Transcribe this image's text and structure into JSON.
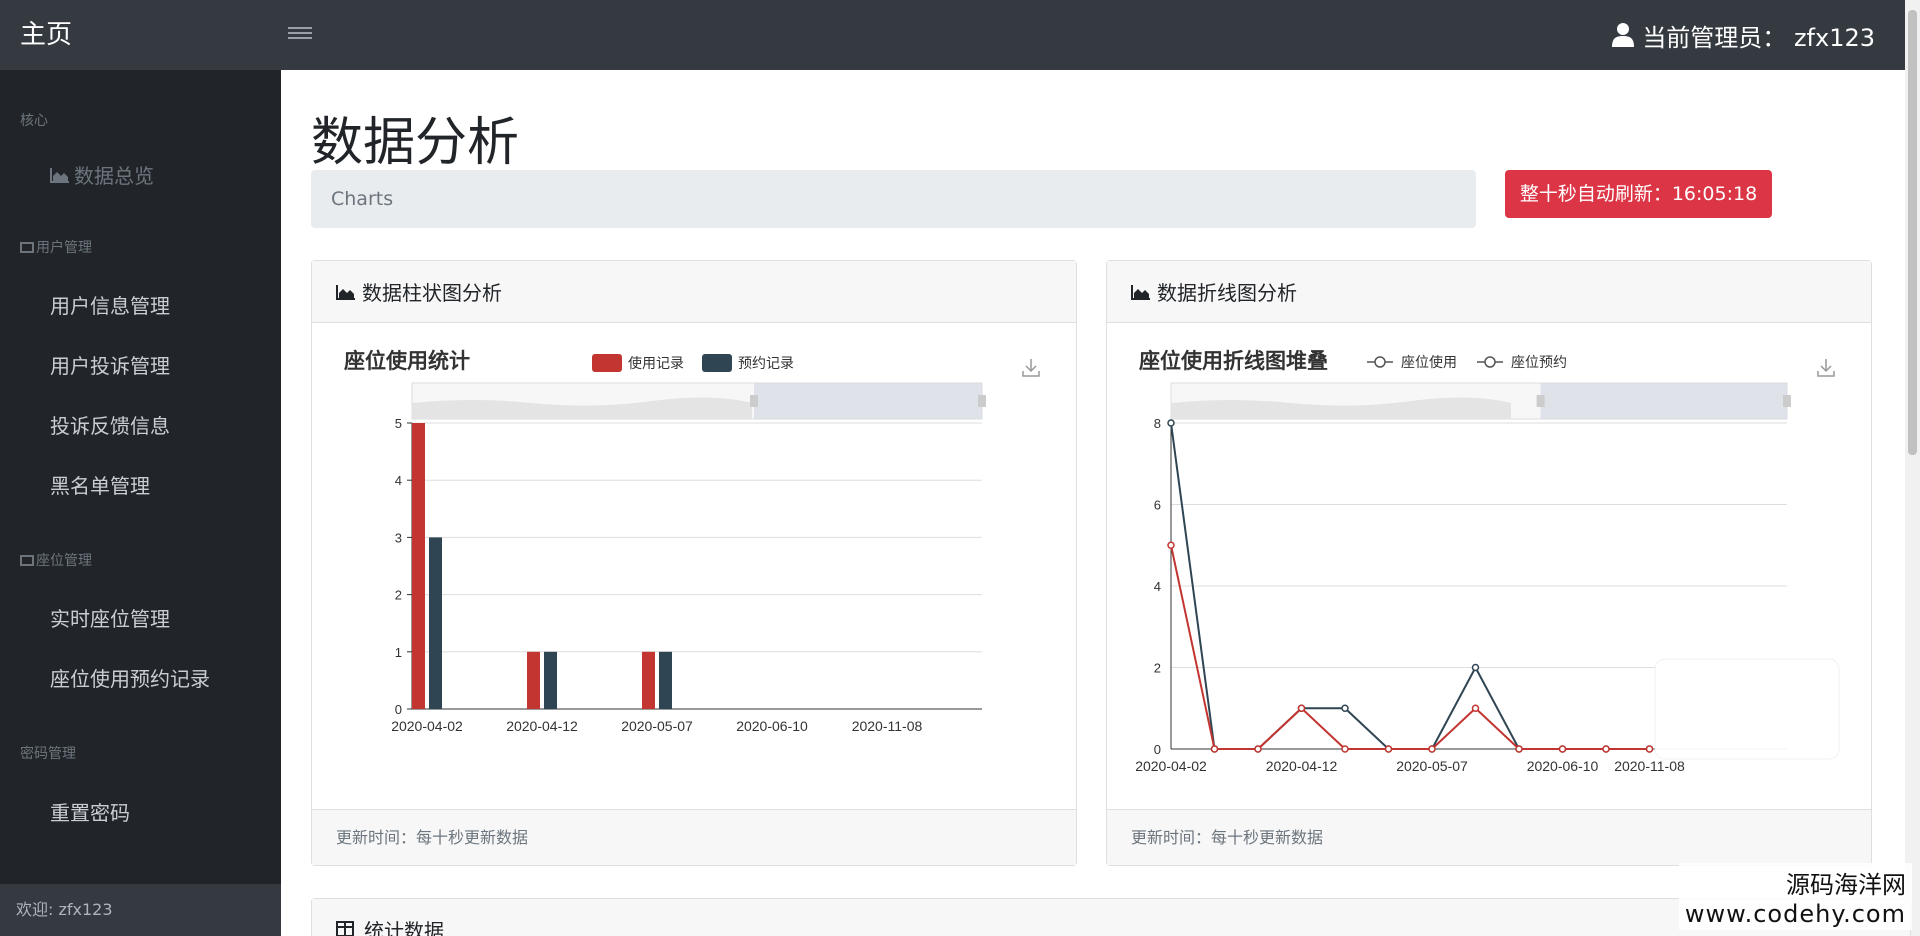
{
  "navbar": {
    "brand": "主页",
    "admin_label": "当前管理员：  zfx123"
  },
  "sidebar": {
    "sections": [
      {
        "heading": "核心",
        "items": [
          {
            "label": "数据总览",
            "icon": "area-chart-icon"
          }
        ]
      },
      {
        "heading": "用户管理",
        "items": [
          {
            "label": "用户信息管理"
          },
          {
            "label": "用户投诉管理"
          },
          {
            "label": "投诉反馈信息"
          },
          {
            "label": "黑名单管理"
          }
        ]
      },
      {
        "heading": "座位管理",
        "items": [
          {
            "label": "实时座位管理"
          },
          {
            "label": "座位使用预约记录"
          }
        ]
      },
      {
        "heading": "密码管理",
        "items": [
          {
            "label": "重置密码"
          }
        ]
      }
    ],
    "footer": "欢迎: zfx123"
  },
  "main": {
    "title": "数据分析",
    "breadcrumb": "Charts",
    "refresh_label": "整十秒自动刷新：16:05:18",
    "bar_card": {
      "header": "数据柱状图分析",
      "footer": "更新时间：每十秒更新数据"
    },
    "line_card": {
      "header": "数据折线图分析",
      "footer": "更新时间：每十秒更新数据"
    },
    "stats_card": {
      "header": "统计数据"
    }
  },
  "chart_data": [
    {
      "type": "bar",
      "title": "座位使用统计",
      "categories": [
        "2020-04-02",
        "2020-04-12",
        "2020-05-07",
        "2020-06-10",
        "2020-11-08"
      ],
      "series": [
        {
          "name": "使用记录",
          "color": "#c23531",
          "values": [
            5,
            1,
            1,
            0,
            0
          ]
        },
        {
          "name": "预约记录",
          "color": "#2f4554",
          "values": [
            3,
            1,
            1,
            0,
            0
          ]
        }
      ],
      "ylim": [
        0,
        5
      ],
      "yticks": [
        0,
        1,
        2,
        3,
        4,
        5
      ],
      "legend": "top",
      "grid": true
    },
    {
      "type": "line",
      "title": "座位使用折线图堆叠",
      "x": [
        "2020-04-02",
        "",
        "",
        "2020-04-12",
        "",
        "",
        "2020-05-07",
        "",
        "",
        "2020-06-10",
        "",
        "2020-11-08"
      ],
      "xticks": [
        "2020-04-02",
        "2020-04-12",
        "2020-05-07",
        "2020-06-10",
        "2020-11-08"
      ],
      "series": [
        {
          "name": "座位使用",
          "color": "#c23531",
          "values": [
            5,
            0,
            0,
            1,
            0,
            0,
            0,
            1,
            0,
            0,
            0,
            0
          ]
        },
        {
          "name": "座位预约",
          "color": "#2f4554",
          "values": [
            8,
            0,
            0,
            1,
            1,
            0,
            0,
            2,
            0,
            0,
            0,
            0
          ]
        }
      ],
      "ylim": [
        0,
        8
      ],
      "yticks": [
        0,
        2,
        4,
        6,
        8
      ],
      "legend": "top",
      "grid": true
    }
  ],
  "watermark": {
    "line1": "源码海洋网",
    "line2": "www.codehy.com"
  }
}
